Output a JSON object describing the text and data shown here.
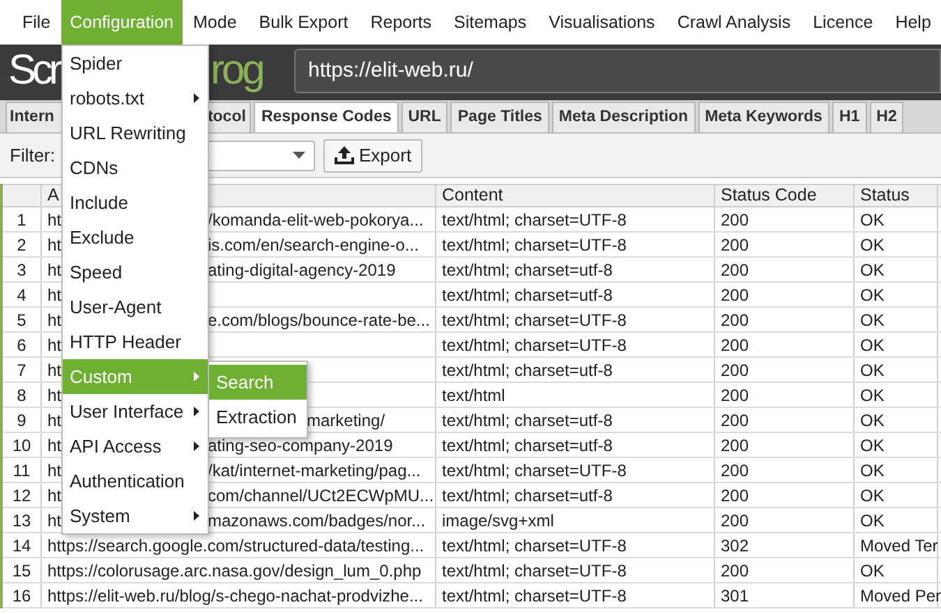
{
  "menu_bar": [
    {
      "label": "File",
      "selected": false
    },
    {
      "label": "Configuration",
      "selected": true
    },
    {
      "label": "Mode",
      "selected": false
    },
    {
      "label": "Bulk Export",
      "selected": false
    },
    {
      "label": "Reports",
      "selected": false
    },
    {
      "label": "Sitemaps",
      "selected": false
    },
    {
      "label": "Visualisations",
      "selected": false
    },
    {
      "label": "Crawl Analysis",
      "selected": false
    },
    {
      "label": "Licence",
      "selected": false
    },
    {
      "label": "Help",
      "selected": false
    }
  ],
  "header": {
    "logo_start": "Scr",
    "logo_end": "rog",
    "url": "https://elit-web.ru/"
  },
  "tabs": [
    {
      "label": "Intern",
      "selected": false
    },
    {
      "label": "tocol",
      "selected": false
    },
    {
      "label": "Response Codes",
      "selected": true
    },
    {
      "label": "URL",
      "selected": false
    },
    {
      "label": "Page Titles",
      "selected": false
    },
    {
      "label": "Meta Description",
      "selected": false
    },
    {
      "label": "Meta Keywords",
      "selected": false
    },
    {
      "label": "H1",
      "selected": false
    },
    {
      "label": "H2",
      "selected": false
    }
  ],
  "toolbar": {
    "filter_label": "Filter:",
    "export_button": "Export"
  },
  "table": {
    "columns": [
      "A",
      "Content",
      "Status Code",
      "Status"
    ],
    "rows": [
      {
        "number": "1",
        "address_start": "ht",
        "address_end": "/komanda-elit-web-pokorya...",
        "content": "text/html; charset=UTF-8",
        "status_code": "200",
        "status": "OK"
      },
      {
        "number": "2",
        "address_start": "ht",
        "address_end": "is.com/en/search-engine-o...",
        "content": "text/html; charset=UTF-8",
        "status_code": "200",
        "status": "OK"
      },
      {
        "number": "3",
        "address_start": "ht",
        "address_end": "ating-digital-agency-2019",
        "content": "text/html; charset=utf-8",
        "status_code": "200",
        "status": "OK"
      },
      {
        "number": "4",
        "address_start": "ht",
        "content": "text/html; charset=utf-8",
        "status_code": "200",
        "status": "OK"
      },
      {
        "number": "5",
        "address_start": "ht",
        "address_end": "e.com/blogs/bounce-rate-be...",
        "content": "text/html; charset=UTF-8",
        "status_code": "200",
        "status": "OK"
      },
      {
        "number": "6",
        "address_start": "ht",
        "content": "text/html; charset=UTF-8",
        "status_code": "200",
        "status": "OK"
      },
      {
        "number": "7",
        "address_start": "ht",
        "content": "text/html; charset=utf-8",
        "status_code": "200",
        "status": "OK"
      },
      {
        "number": "8",
        "address_start": "ht",
        "content": "text/html",
        "status_code": "200",
        "status": "OK"
      },
      {
        "number": "9",
        "address_start": "ht",
        "address_end": "marketing/",
        "content": "text/html; charset=utf-8",
        "status_code": "200",
        "status": "OK"
      },
      {
        "number": "10",
        "address_start": "ht",
        "address_end": "ating-seo-company-2019",
        "content": "text/html; charset=utf-8",
        "status_code": "200",
        "status": "OK"
      },
      {
        "number": "11",
        "address_start": "ht",
        "address_end": "/kat/internet-marketing/pag...",
        "content": "text/html; charset=UTF-8",
        "status_code": "200",
        "status": "OK"
      },
      {
        "number": "12",
        "address_start": "ht",
        "address_end": "com/channel/UCt2ECWpMU...",
        "content": "text/html; charset=utf-8",
        "status_code": "200",
        "status": "OK"
      },
      {
        "number": "13",
        "address_start": "ht",
        "address_end": "mazonaws.com/badges/nor...",
        "content": "image/svg+xml",
        "status_code": "200",
        "status": "OK"
      },
      {
        "number": "14",
        "address": "https://search.google.com/structured-data/testing...",
        "content": "text/html; charset=UTF-8",
        "status_code": "302",
        "status": "Moved Ter"
      },
      {
        "number": "15",
        "address": "https://colorusage.arc.nasa.gov/design_lum_0.php",
        "content": "text/html; charset=UTF-8",
        "status_code": "200",
        "status": "OK"
      },
      {
        "number": "16",
        "address": "https://elit-web.ru/blog/s-chego-nachat-prodvizhe...",
        "content": "text/html; charset=UTF-8",
        "status_code": "301",
        "status": "Moved Per"
      }
    ]
  },
  "configuration_menu": [
    {
      "label": "Spider",
      "submenu": false,
      "selected": false
    },
    {
      "label": "robots.txt",
      "submenu": true,
      "selected": false
    },
    {
      "label": "URL Rewriting",
      "submenu": false,
      "selected": false
    },
    {
      "label": "CDNs",
      "submenu": false,
      "selected": false
    },
    {
      "label": "Include",
      "submenu": false,
      "selected": false
    },
    {
      "label": "Exclude",
      "submenu": false,
      "selected": false
    },
    {
      "label": "Speed",
      "submenu": false,
      "selected": false
    },
    {
      "label": "User-Agent",
      "submenu": false,
      "selected": false
    },
    {
      "label": "HTTP Header",
      "submenu": false,
      "selected": false
    },
    {
      "label": "Custom",
      "submenu": true,
      "selected": true
    },
    {
      "label": "User Interface",
      "submenu": true,
      "selected": false
    },
    {
      "label": "API Access",
      "submenu": true,
      "selected": false
    },
    {
      "label": "Authentication",
      "submenu": false,
      "selected": false
    },
    {
      "label": "System",
      "submenu": true,
      "selected": false
    }
  ],
  "custom_submenu": [
    {
      "label": "Search",
      "selected": true
    },
    {
      "label": "Extraction",
      "selected": false
    }
  ]
}
